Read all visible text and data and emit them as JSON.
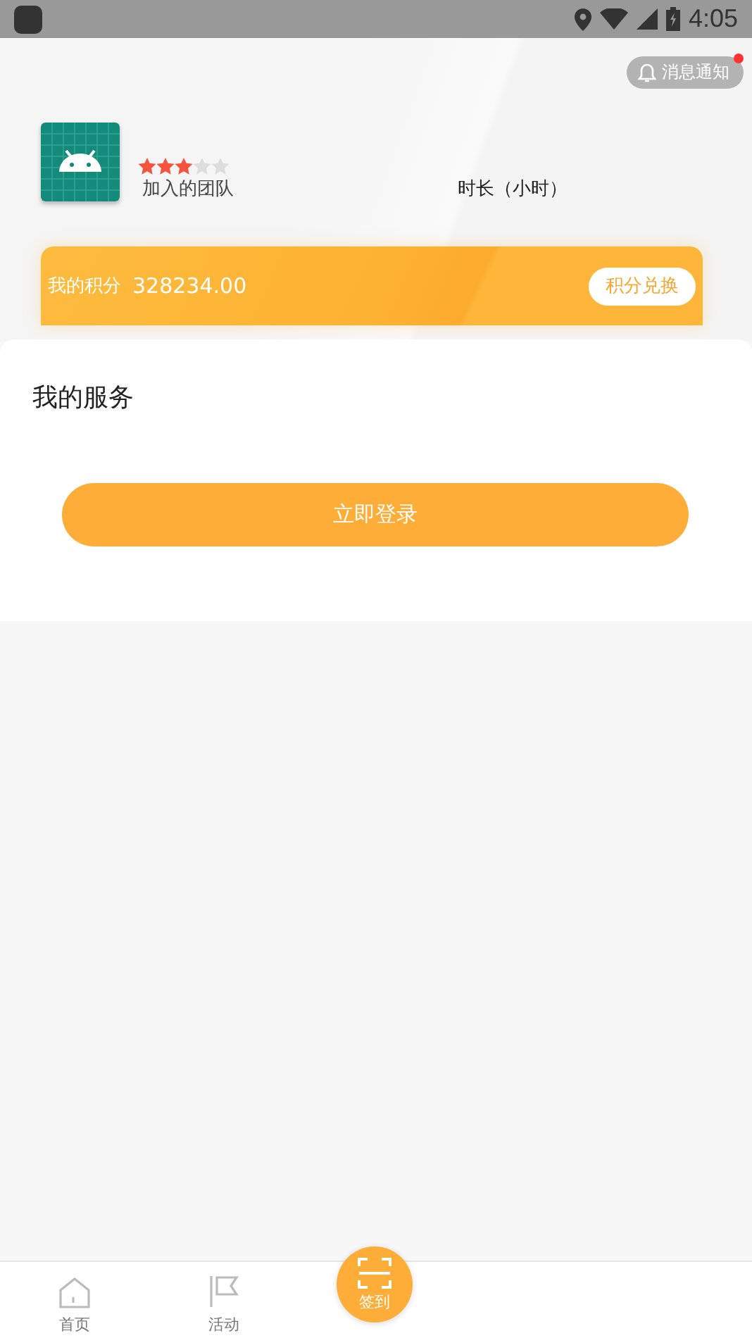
{
  "status_bar": {
    "time": "4:05"
  },
  "notice_button": {
    "label": "消息通知",
    "unread": true
  },
  "profile": {
    "stars": 3,
    "team_label": "加入的团队",
    "hours_label": "时长（小时）"
  },
  "points_card": {
    "label": "我的积分",
    "value": "328234.00",
    "button": "积分兑换"
  },
  "services": {
    "title": "我的服务",
    "login_button": "立即登录"
  },
  "tab_bar": [
    {
      "label": "首页",
      "kind": "home",
      "selected": false
    },
    {
      "label": "活动",
      "kind": "flag",
      "selected": false
    },
    {
      "label": "签到",
      "kind": "scan"
    }
  ]
}
